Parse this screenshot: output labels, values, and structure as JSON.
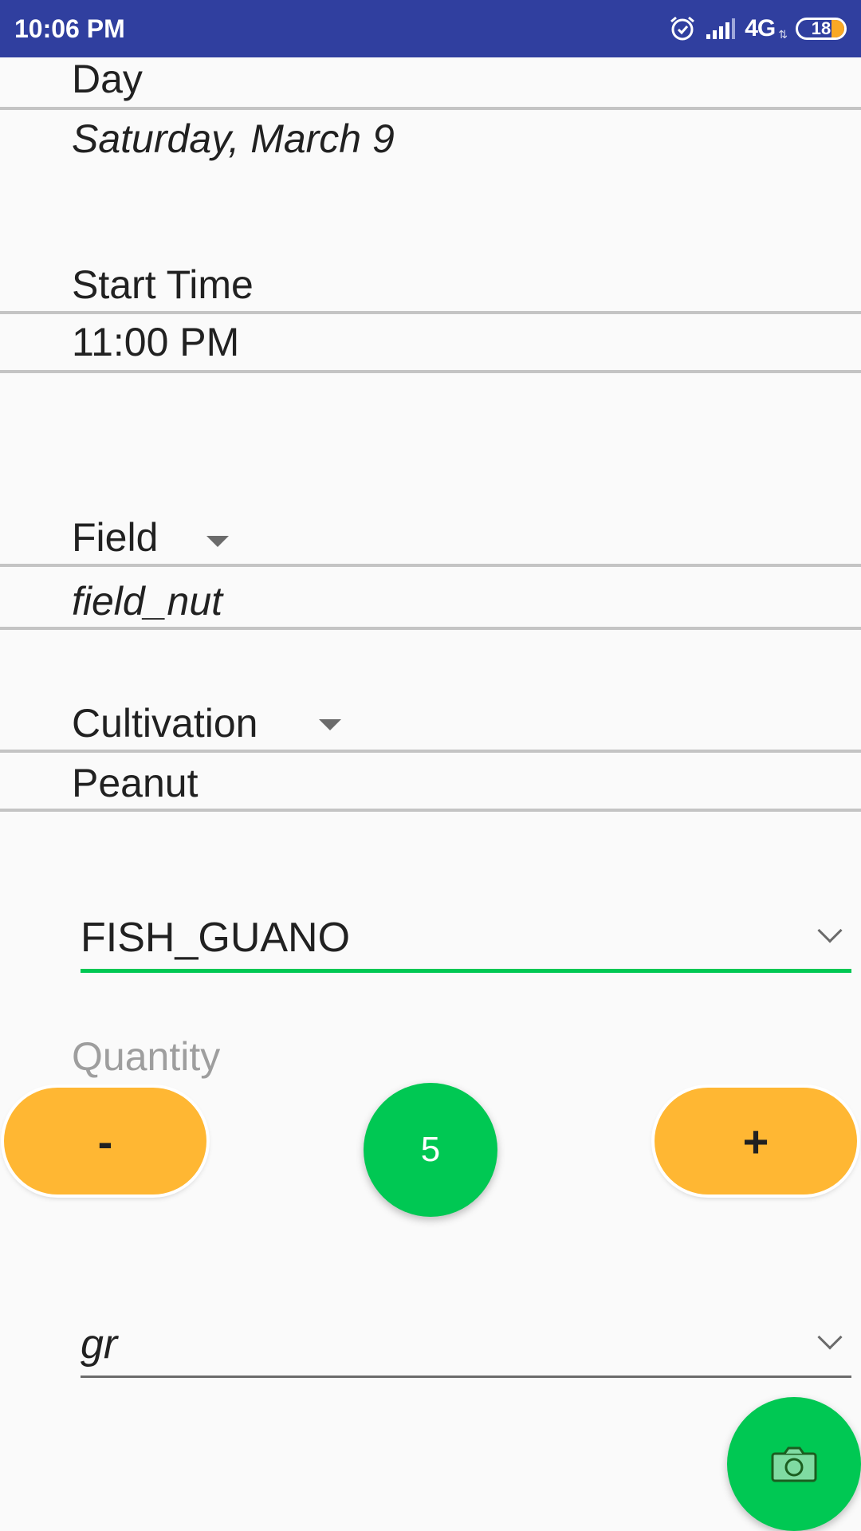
{
  "status_bar": {
    "time": "10:06 PM",
    "network": "4G",
    "battery": "18",
    "icons": [
      "alarm-icon",
      "signal-icon",
      "battery-icon"
    ]
  },
  "form": {
    "day": {
      "label": "Day",
      "value": "Saturday, March 9"
    },
    "start_time": {
      "label": "Start Time",
      "value": "11:00 PM"
    },
    "field": {
      "label": "Field",
      "value": "field_nut"
    },
    "cultivation": {
      "label": "Cultivation",
      "value": "Peanut"
    },
    "fertilizer_spinner": {
      "selected": "FISH_GUANO",
      "underline_color": "#00c853"
    },
    "quantity": {
      "label": "Quantity",
      "minus_label": "-",
      "plus_label": "+",
      "value": "5"
    },
    "unit_spinner": {
      "selected": "gr"
    },
    "camera_button": {
      "icon": "camera-icon"
    }
  },
  "colors": {
    "status_bar": "#303f9f",
    "accent_green": "#00c853",
    "button_orange": "#ffb733"
  }
}
